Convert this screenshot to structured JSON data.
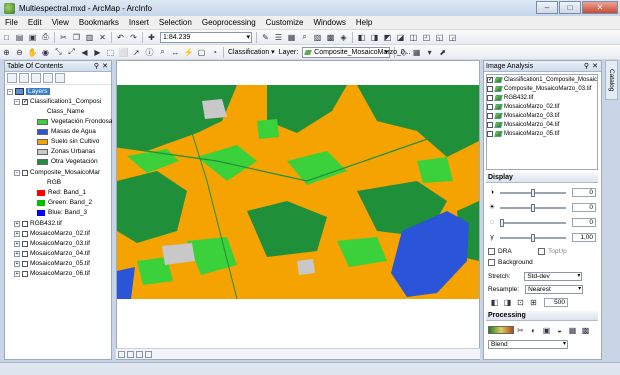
{
  "window": {
    "title": "Multiespectral.mxd - ArcMap - ArcInfo"
  },
  "menu": [
    "File",
    "Edit",
    "View",
    "Bookmarks",
    "Insert",
    "Selection",
    "Geoprocessing",
    "Customize",
    "Windows",
    "Help"
  ],
  "toolbar": {
    "scale": "1:84.239",
    "classification_label": "Classification ▾",
    "layer_label": "Layer:",
    "layer_value": "Composite_MosaicoMarzo_0..."
  },
  "toc": {
    "title": "Table Of Contents",
    "layers_label": "Layers",
    "classification_layer": "Classification1_Composi",
    "class_name_header": "Class_Name",
    "classes": [
      {
        "label": "Vegetación Frondosa",
        "color": "#3bd13b"
      },
      {
        "label": "Masas de Agua",
        "color": "#2b55d8"
      },
      {
        "label": "Suelo sin Cultivo",
        "color": "#f5a300"
      },
      {
        "label": "Zonas Urbanas",
        "color": "#c8c8c8"
      },
      {
        "label": "Otra Vegetación",
        "color": "#1f8f3a"
      }
    ],
    "composite_layer": "Composite_MosaicoMar",
    "rgb_label": "RGB",
    "bands": [
      {
        "label": "Red:",
        "band": "Band_1",
        "color": "#ff0000"
      },
      {
        "label": "Green:",
        "band": "Band_2",
        "color": "#00c000"
      },
      {
        "label": "Blue:",
        "band": "Band_3",
        "color": "#0000ff"
      }
    ],
    "other_layers": [
      "RGB432.tif",
      "MosaicoMarzo_02.tif",
      "MosaicoMarzo_03.tif",
      "MosaicoMarzo_04.tif",
      "MosaicoMarzo_05.tif",
      "MosaicoMarzo_06.tif"
    ]
  },
  "image_analysis": {
    "title": "Image Analysis",
    "items": [
      "Classification1_Composite_Mosaic",
      "Composite_MosaicoMarzo_03.tif",
      "RGB432.tif",
      "MosaicoMarzo_02.tif",
      "MosaicoMarzo_03.tif",
      "MosaicoMarzo_04.tif",
      "MosaicoMarzo_05.tif"
    ],
    "display_label": "Display",
    "sliders": [
      {
        "icon": "◑",
        "value": "0",
        "level": 0.5
      },
      {
        "icon": "☀",
        "value": "0",
        "level": 0.5
      },
      {
        "icon": "◌",
        "value": "0",
        "level": 0.0
      },
      {
        "icon": "γ",
        "value": "1,00",
        "level": 0.5
      }
    ],
    "dra_label": "DRA",
    "topup_label": "TopUp",
    "background_label": "Background",
    "stretch_label": "Stretch:",
    "stretch_value": "Std-dev",
    "resample_label": "Resample:",
    "resample_value": "Nearest",
    "opacity_value": "500",
    "processing_label": "Processing",
    "blend_label": "Blend"
  },
  "catalog_label": "Catalog",
  "colors": {
    "orange": "#f5a300",
    "green": "#1f8f3a",
    "bright_green": "#3bd13b",
    "water": "#2b55d8",
    "urban": "#c8c8c8"
  }
}
